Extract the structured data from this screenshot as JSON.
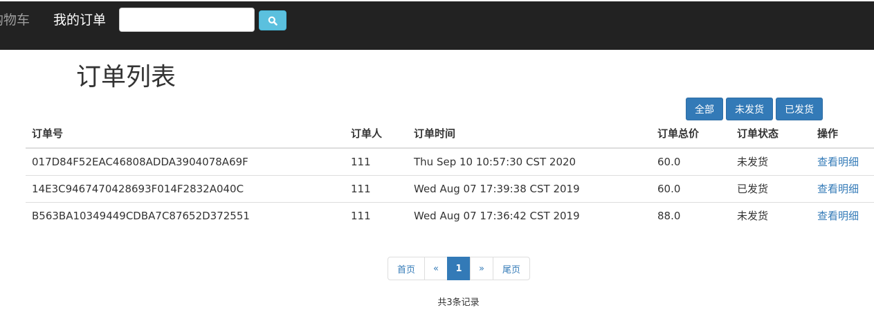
{
  "navbar": {
    "cart_label": "购物车",
    "orders_label": "我的订单",
    "search_placeholder": "",
    "search_button_icon": "search-icon"
  },
  "page": {
    "title": "订单列表"
  },
  "filters": {
    "all": "全部",
    "unshipped": "未发货",
    "shipped": "已发货"
  },
  "table": {
    "headers": [
      "订单号",
      "订单人",
      "订单时间",
      "订单总价",
      "订单状态",
      "操作"
    ],
    "rows": [
      {
        "id": "017D84F52EAC46808ADDA3904078A69F",
        "user": "111",
        "time": "Thu Sep 10 10:57:30 CST 2020",
        "total": "60.0",
        "status": "未发货",
        "action": "查看明细"
      },
      {
        "id": "14E3C9467470428693F014F2832A040C",
        "user": "111",
        "time": "Wed Aug 07 17:39:38 CST 2019",
        "total": "60.0",
        "status": "已发货",
        "action": "查看明细"
      },
      {
        "id": "B563BA10349449CDBA7C87652D372551",
        "user": "111",
        "time": "Wed Aug 07 17:36:42 CST 2019",
        "total": "88.0",
        "status": "未发货",
        "action": "查看明细"
      }
    ]
  },
  "pagination": {
    "first": "首页",
    "prev": "«",
    "current": "1",
    "next": "»",
    "last": "尾页"
  },
  "footer": {
    "total_text": "共3条记录"
  },
  "colors": {
    "navbar_bg": "#222222",
    "primary": "#337ab7",
    "info": "#5bc0de"
  }
}
